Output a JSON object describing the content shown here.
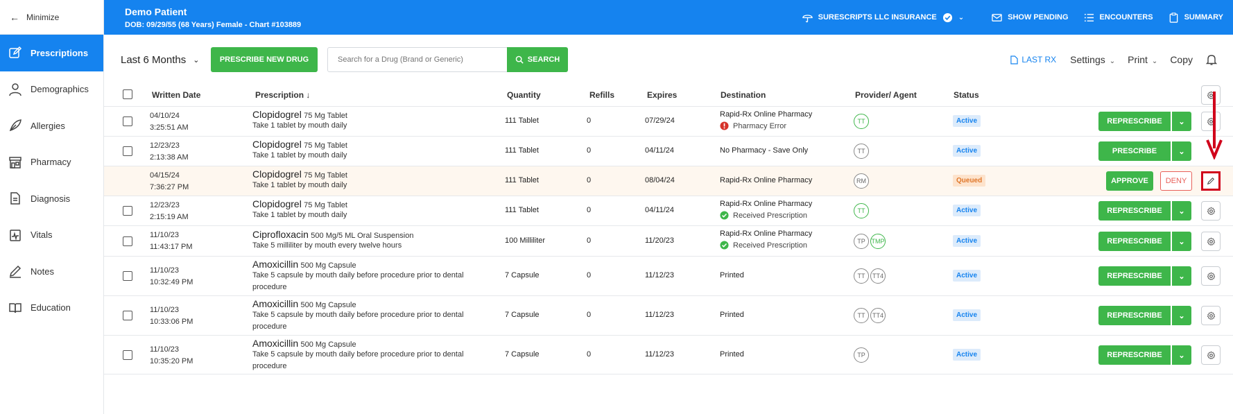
{
  "sidebar": {
    "minimize_label": "Minimize",
    "items": [
      {
        "label": "Prescriptions",
        "icon": "edit-square-icon",
        "active": true
      },
      {
        "label": "Demographics",
        "icon": "person-icon",
        "active": false
      },
      {
        "label": "Allergies",
        "icon": "feather-icon",
        "active": false
      },
      {
        "label": "Pharmacy",
        "icon": "store-icon",
        "active": false
      },
      {
        "label": "Diagnosis",
        "icon": "document-icon",
        "active": false
      },
      {
        "label": "Vitals",
        "icon": "clipboard-pulse-icon",
        "active": false
      },
      {
        "label": "Notes",
        "icon": "pencil-icon",
        "active": false
      },
      {
        "label": "Education",
        "icon": "book-icon",
        "active": false
      }
    ]
  },
  "header": {
    "patient_name": "Demo Patient",
    "patient_details": "DOB: 09/29/55 (68 Years) Female - Chart #103889",
    "insurance": "SURESCRIPTS LLC INSURANCE",
    "show_pending": "SHOW PENDING",
    "encounters": "ENCOUNTERS",
    "summary": "SUMMARY",
    "accent_color": "#1583ef"
  },
  "toolbar": {
    "period": "Last 6 Months",
    "prescribe_new": "PRESCRIBE NEW DRUG",
    "search_placeholder": "Search for a Drug (Brand or Generic)",
    "search_button": "SEARCH",
    "last_rx": "LAST RX",
    "settings": "Settings",
    "print": "Print",
    "copy": "Copy"
  },
  "table": {
    "headers": {
      "written_date": "Written Date",
      "prescription": "Prescription",
      "quantity": "Quantity",
      "refills": "Refills",
      "expires": "Expires",
      "destination": "Destination",
      "provider": "Provider/ Agent",
      "status": "Status"
    },
    "rows": [
      {
        "date": "04/10/24",
        "time": "3:25:51 AM",
        "drug": "Clopidogrel",
        "form": "75 Mg Tablet",
        "sig": "Take 1 tablet by mouth daily",
        "quantity": "111 Tablet",
        "refills": "0",
        "expires": "07/29/24",
        "destination": "Rapid-Rx Online Pharmacy",
        "dest_status": "Pharmacy Error",
        "dest_status_type": "error",
        "providers": [
          {
            "initials": "TT",
            "green": true
          }
        ],
        "status": "Active",
        "action": "REPRESCRIBE"
      },
      {
        "date": "12/23/23",
        "time": "2:13:38 AM",
        "drug": "Clopidogrel",
        "form": "75 Mg Tablet",
        "sig": "Take 1 tablet by mouth daily",
        "quantity": "111 Tablet",
        "refills": "0",
        "expires": "04/11/24",
        "destination": "No Pharmacy - Save Only",
        "dest_status": "",
        "dest_status_type": "",
        "providers": [
          {
            "initials": "TT",
            "green": false
          }
        ],
        "status": "Active",
        "action": "PRESCRIBE"
      },
      {
        "date": "04/15/24",
        "time": "7:36:27 PM",
        "drug": "Clopidogrel",
        "form": "75 Mg Tablet",
        "sig": "Take 1 tablet by mouth daily",
        "quantity": "111 Tablet",
        "refills": "0",
        "expires": "08/04/24",
        "destination": "Rapid-Rx Online Pharmacy",
        "dest_status": "",
        "dest_status_type": "",
        "providers": [
          {
            "initials": "RM",
            "green": false
          }
        ],
        "status": "Queued",
        "approve": "APPROVE",
        "deny": "DENY"
      },
      {
        "date": "12/23/23",
        "time": "2:15:19 AM",
        "drug": "Clopidogrel",
        "form": "75 Mg Tablet",
        "sig": "Take 1 tablet by mouth daily",
        "quantity": "111 Tablet",
        "refills": "0",
        "expires": "04/11/24",
        "destination": "Rapid-Rx Online Pharmacy",
        "dest_status": "Received Prescription",
        "dest_status_type": "ok",
        "providers": [
          {
            "initials": "TT",
            "green": true
          }
        ],
        "status": "Active",
        "action": "REPRESCRIBE"
      },
      {
        "date": "11/10/23",
        "time": "11:43:17 PM",
        "drug": "Ciprofloxacin",
        "form": "500 Mg/5 ML Oral Suspension",
        "sig": "Take 5 milliliter by mouth every twelve hours",
        "quantity": "100 Milliliter",
        "refills": "0",
        "expires": "11/20/23",
        "destination": "Rapid-Rx Online Pharmacy",
        "dest_status": "Received Prescription",
        "dest_status_type": "ok",
        "providers": [
          {
            "initials": "TP",
            "green": false
          },
          {
            "initials": "TMP",
            "green": true
          }
        ],
        "status": "Active",
        "action": "REPRESCRIBE"
      },
      {
        "date": "11/10/23",
        "time": "10:32:49 PM",
        "drug": "Amoxicillin",
        "form": "500 Mg Capsule",
        "sig": "Take 5 capsule by mouth daily before procedure prior to dental procedure",
        "quantity": "7 Capsule",
        "refills": "0",
        "expires": "11/12/23",
        "destination": "Printed",
        "dest_status": "",
        "dest_status_type": "",
        "providers": [
          {
            "initials": "TT",
            "green": false
          },
          {
            "initials": "TT4",
            "green": false
          }
        ],
        "status": "Active",
        "action": "REPRESCRIBE"
      },
      {
        "date": "11/10/23",
        "time": "10:33:06 PM",
        "drug": "Amoxicillin",
        "form": "500 Mg Capsule",
        "sig": "Take 5 capsule by mouth daily before procedure prior to dental procedure",
        "quantity": "7 Capsule",
        "refills": "0",
        "expires": "11/12/23",
        "destination": "Printed",
        "dest_status": "",
        "dest_status_type": "",
        "providers": [
          {
            "initials": "TT",
            "green": false
          },
          {
            "initials": "TT4",
            "green": false
          }
        ],
        "status": "Active",
        "action": "REPRESCRIBE"
      },
      {
        "date": "11/10/23",
        "time": "10:35:20 PM",
        "drug": "Amoxicillin",
        "form": "500 Mg Capsule",
        "sig": "Take 5 capsule by mouth daily before procedure prior to dental procedure",
        "quantity": "7 Capsule",
        "refills": "0",
        "expires": "11/12/23",
        "destination": "Printed",
        "dest_status": "",
        "dest_status_type": "",
        "providers": [
          {
            "initials": "TP",
            "green": false
          }
        ],
        "status": "Active",
        "action": "REPRESCRIBE"
      }
    ]
  }
}
